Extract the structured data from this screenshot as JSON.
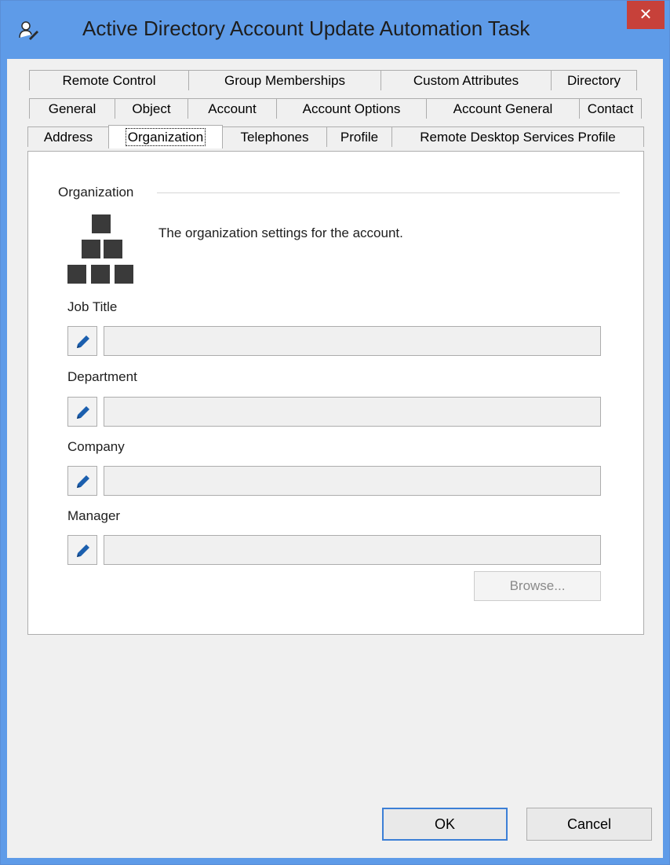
{
  "window": {
    "title": "Active Directory Account Update Automation Task",
    "close_label": "✕",
    "icon": "user-edit-icon"
  },
  "tabs": {
    "row1": [
      "Remote Control",
      "Group Memberships",
      "Custom Attributes",
      "Directory"
    ],
    "row2": [
      "General",
      "Object",
      "Account",
      "Account Options",
      "Account General",
      "Contact"
    ],
    "row3": [
      "Address",
      "Organization",
      "Telephones",
      "Profile",
      "Remote Desktop Services Profile"
    ],
    "active": "Organization"
  },
  "panel": {
    "group_label": "Organization",
    "icon": "organization-icon",
    "description": "The organization settings for the account."
  },
  "fields": [
    {
      "label": "Job Title",
      "value": ""
    },
    {
      "label": "Department",
      "value": ""
    },
    {
      "label": "Company",
      "value": ""
    },
    {
      "label": "Manager",
      "value": ""
    }
  ],
  "browse_label": "Browse...",
  "buttons": {
    "ok": "OK",
    "cancel": "Cancel"
  },
  "colors": {
    "titlebar": "#5e9be8",
    "close": "#c7413a",
    "pencil": "#1b5fae"
  }
}
